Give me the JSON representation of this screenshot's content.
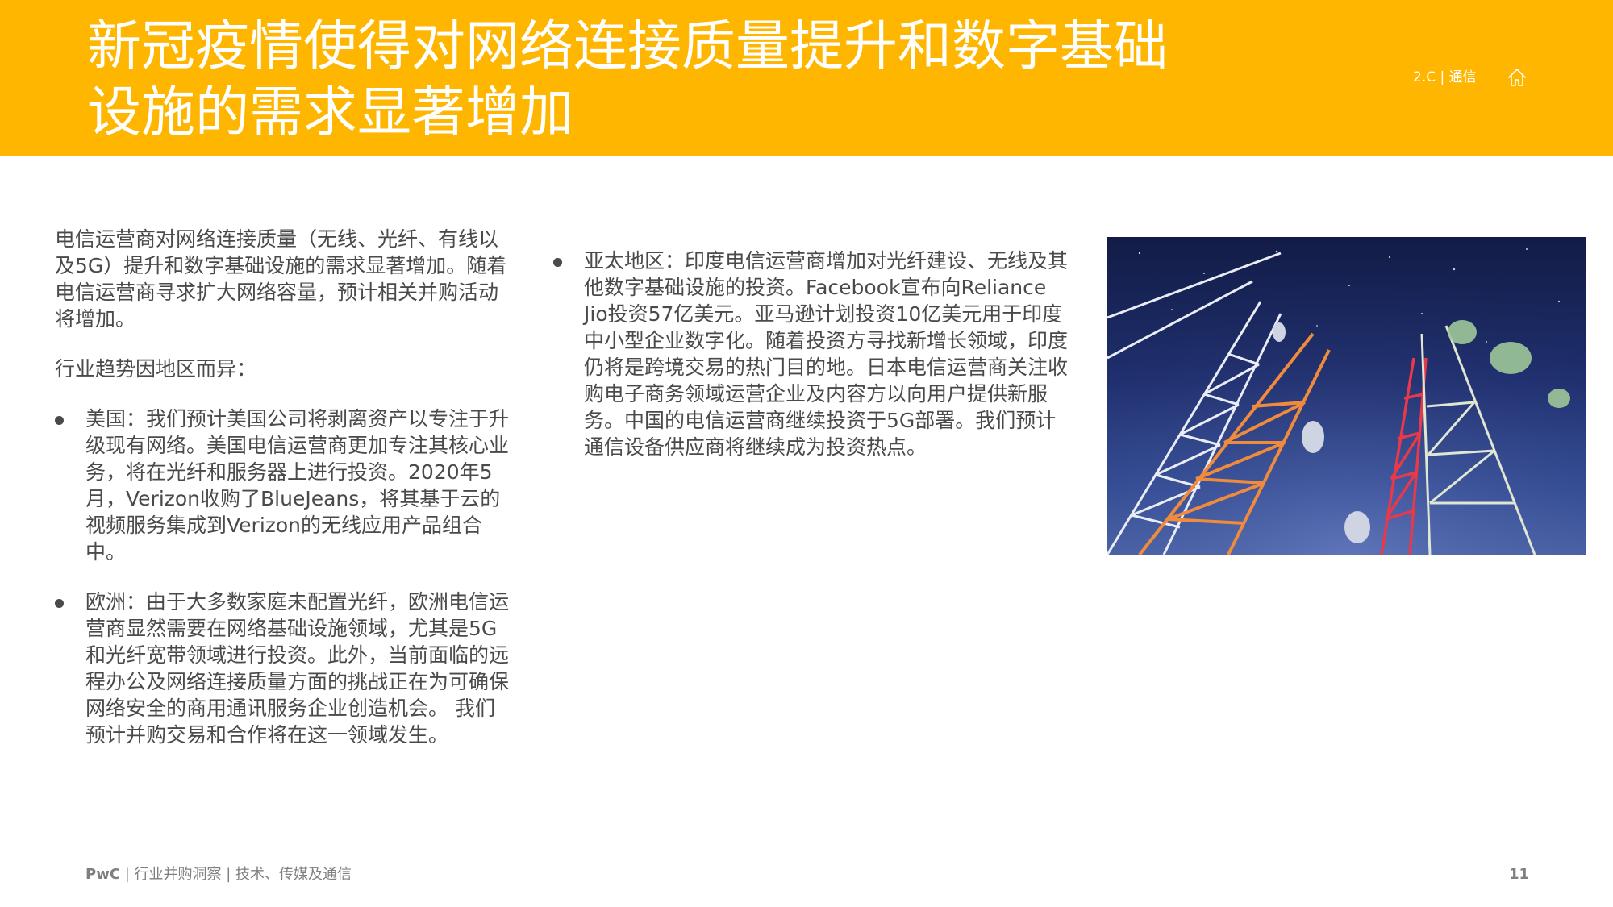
{
  "header": {
    "title_line1": "新冠疫情使得对网络连接质量提升和数字基础",
    "title_line2": "设施的需求显著增加",
    "section_ref": "2.C | 通信",
    "home_icon": "home-icon",
    "color": "#FFB600"
  },
  "left_column": {
    "intro": "电信运营商对网络连接质量（无线、光纤、有线以及5G）提升和数字基础设施的需求显著增加。随着电信运营商寻求扩大网络容量，预计相关并购活动将增加。",
    "trend_heading": "行业趋势因地区而异：",
    "bullets": [
      {
        "text": "美国：我们预计美国公司将剥离资产以专注于升级现有网络。美国电信运营商更加专注其核心业务，将在光纤和服务器上进行投资。2020年5月，Verizon收购了BlueJeans，将其基于云的视频服务集成到Verizon的无线应用产品组合中。"
      },
      {
        "text": "欧洲：由于大多数家庭未配置光纤，欧洲电信运营商显然需要在网络基础设施领域，尤其是5G和光纤宽带领域进行投资。此外，当前面临的远程办公及网络连接质量方面的挑战正在为可确保网络安全的商用通讯服务企业创造机会。 我们预计并购交易和合作将在这一领域发生。"
      }
    ]
  },
  "middle_column": {
    "bullets": [
      {
        "text": "亚太地区：印度电信运营商增加对光纤建设、无线及其他数字基础设施的投资。Facebook宣布向Reliance Jio投资57亿美元。亚马逊计划投资10亿美元用于印度中小型企业数字化。随着投资方寻找新增长领域，印度仍将是跨境交易的热门目的地。日本电信运营商关注收购电子商务领域运营企业及内容方以向用户提供新服务。中国的电信运营商继续投资于5G部署。我们预计通信设备供应商将继续成为投资热点。"
      }
    ]
  },
  "footer": {
    "brand": "PwC",
    "text": " | 行业并购洞察 | 技术、传媒及通信",
    "page_number": "11"
  }
}
